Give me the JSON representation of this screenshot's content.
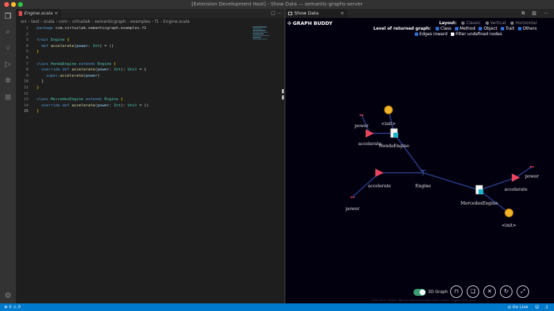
{
  "window": {
    "title": "[Extension Development Host] - Show Data — semantic-graphs-server"
  },
  "activity_bar": {
    "icons": [
      "files-icon",
      "search-icon",
      "source-control-icon",
      "run-debug-icon",
      "extensions-icon",
      "remote-icon",
      "settings-gear-icon"
    ]
  },
  "editor": {
    "tab_label": "Engine.scala",
    "tab_close": "×",
    "tab_tools": "▢ ⋯",
    "breadcrumbs": [
      "src",
      "test",
      "scala",
      "com",
      "virtuslab",
      "semanticgraph",
      "examples",
      "f1",
      "Engine.scala"
    ],
    "lines": [
      {
        "n": "1",
        "code": [
          [
            "kw",
            "package "
          ],
          [
            "tx",
            "com.virtuslab.semanticgraph.examples.f1"
          ]
        ]
      },
      {
        "n": "2",
        "code": []
      },
      {
        "n": "3",
        "code": [
          [
            "kw",
            "trait "
          ],
          [
            "ty",
            "Engine "
          ],
          [
            "br",
            "{"
          ]
        ]
      },
      {
        "n": "4",
        "code": [
          [
            "tx",
            "  "
          ],
          [
            "kw",
            "def "
          ],
          [
            "fn",
            "accelerate"
          ],
          [
            "tx",
            "("
          ],
          [
            "pa",
            "power"
          ],
          [
            "tx",
            ": "
          ],
          [
            "ty",
            "Int"
          ],
          [
            "tx",
            ") = ()"
          ]
        ]
      },
      {
        "n": "5",
        "code": [
          [
            "br",
            "}"
          ]
        ]
      },
      {
        "n": "6",
        "code": []
      },
      {
        "n": "7",
        "code": [
          [
            "kw",
            "class "
          ],
          [
            "ty",
            "HondaEngine "
          ],
          [
            "kw",
            "extends "
          ],
          [
            "ty",
            "Engine "
          ],
          [
            "br",
            "{"
          ]
        ]
      },
      {
        "n": "8",
        "code": [
          [
            "tx",
            "  "
          ],
          [
            "kw",
            "override def "
          ],
          [
            "fn",
            "accelerate"
          ],
          [
            "tx",
            "("
          ],
          [
            "pa",
            "power"
          ],
          [
            "tx",
            ": "
          ],
          [
            "ty",
            "Int"
          ],
          [
            "tx",
            "): "
          ],
          [
            "ty",
            "Unit"
          ],
          [
            "tx",
            " = {"
          ]
        ]
      },
      {
        "n": "9",
        "code": [
          [
            "tx",
            "    "
          ],
          [
            "kw",
            "super"
          ],
          [
            "tx",
            "."
          ],
          [
            "fn",
            "accelerate"
          ],
          [
            "tx",
            "("
          ],
          [
            "pa",
            "power"
          ],
          [
            "tx",
            ")"
          ]
        ]
      },
      {
        "n": "10",
        "code": [
          [
            "tx",
            "  }"
          ]
        ]
      },
      {
        "n": "11",
        "code": [
          [
            "br",
            "}"
          ]
        ]
      },
      {
        "n": "12",
        "code": []
      },
      {
        "n": "13",
        "code": [
          [
            "kw",
            "class "
          ],
          [
            "ty",
            "MercedesEngine "
          ],
          [
            "kw",
            "extends "
          ],
          [
            "ty",
            "Engine "
          ],
          [
            "br",
            "{"
          ]
        ]
      },
      {
        "n": "14",
        "code": [
          [
            "tx",
            "  "
          ],
          [
            "kw",
            "override def "
          ],
          [
            "fn",
            "accelerate"
          ],
          [
            "tx",
            "("
          ],
          [
            "pa",
            "power"
          ],
          [
            "tx",
            ": "
          ],
          [
            "ty",
            "Int"
          ],
          [
            "tx",
            "): "
          ],
          [
            "ty",
            "Unit"
          ],
          [
            "tx",
            " = ()"
          ]
        ]
      },
      {
        "n": "15",
        "code": [
          [
            "br",
            "}"
          ]
        ]
      }
    ],
    "current_line": "15"
  },
  "panel": {
    "tab_label": "Show Data",
    "tab_close": "×",
    "tab_tools": "⧉ ▥ ⋯",
    "brand": "GRAPH BUDDY",
    "layout_label": "Layout:",
    "layout_options": [
      "Classic",
      "Vertical",
      "Horizontal"
    ],
    "level_label": "Level of returned graph:",
    "level_options": [
      {
        "label": "Class",
        "checked": true
      },
      {
        "label": "Method",
        "checked": true
      },
      {
        "label": "Object",
        "checked": true
      },
      {
        "label": "Trait",
        "checked": true
      },
      {
        "label": "Others",
        "checked": true
      }
    ],
    "extra_options": [
      {
        "label": "Edges inward",
        "checked": true
      },
      {
        "label": "Filter undefined nodes",
        "checked": false
      }
    ],
    "toggle_label": "3D Graph",
    "buttons": [
      "unlock-icon",
      "book-icon",
      "trash-icon",
      "refresh-icon",
      "expand-icon"
    ],
    "hint": "Left-click: rotate, Mouse-wheel/middle-click: zoom, Right-click: pan"
  },
  "graph": {
    "nodes": [
      {
        "id": "power1",
        "label": "power",
        "kind": "param"
      },
      {
        "id": "init1",
        "label": "<init>",
        "kind": "init"
      },
      {
        "id": "acc1",
        "label": "accelerate",
        "kind": "method"
      },
      {
        "id": "honda",
        "label": "HondaEngine",
        "kind": "class"
      },
      {
        "id": "engine",
        "label": "Engine",
        "kind": "trait"
      },
      {
        "id": "acc2",
        "label": "accelerate",
        "kind": "method"
      },
      {
        "id": "power2",
        "label": "power",
        "kind": "param"
      },
      {
        "id": "mercedes",
        "label": "MercedesEngine",
        "kind": "class"
      },
      {
        "id": "acc3",
        "label": "accelerate",
        "kind": "method"
      },
      {
        "id": "power3",
        "label": "power",
        "kind": "param"
      },
      {
        "id": "init2",
        "label": "<init>",
        "kind": "init"
      }
    ],
    "edges": [
      [
        "power1",
        "acc1"
      ],
      [
        "init1",
        "honda"
      ],
      [
        "acc1",
        "honda"
      ],
      [
        "honda",
        "engine"
      ],
      [
        "acc2",
        "engine"
      ],
      [
        "power2",
        "acc2"
      ],
      [
        "mercedes",
        "engine"
      ],
      [
        "acc3",
        "mercedes"
      ],
      [
        "power3",
        "acc3"
      ],
      [
        "init2",
        "mercedes"
      ]
    ]
  },
  "status": {
    "errors": "0",
    "warnings": "0",
    "golive": "Go Live"
  },
  "colors": {
    "accent": "#007acc",
    "method": "#e8455f",
    "class": "#1cb6c8",
    "init": "#f0b429"
  }
}
